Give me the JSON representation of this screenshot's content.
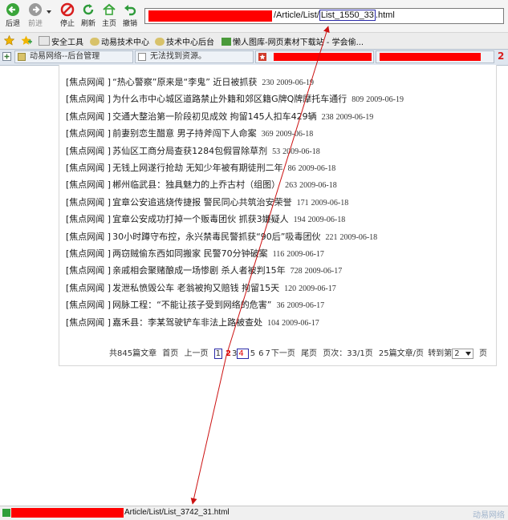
{
  "toolbar": {
    "back_label": "后退",
    "forward_label": "前进",
    "stop_label": "停止",
    "refresh_label": "刷新",
    "home_label": "主页",
    "undo_label": "撤销"
  },
  "address_bar": {
    "path_prefix": "/Article/List/",
    "path_highlight": "List_1550_33",
    "path_suffix": ".html"
  },
  "favorites": [
    {
      "label": "安全工具"
    },
    {
      "label": "动易技术中心"
    },
    {
      "label": "技术中心后台"
    },
    {
      "label": "懒人图库-网页素材下载站 - 学会偷..."
    }
  ],
  "tabs": [
    {
      "label": "动易网络--后台管理"
    },
    {
      "label": "无法找到资源。"
    }
  ],
  "news_list": [
    {
      "source": "[焦点网闻 ]",
      "title": "“热心警察”原来是“李鬼”  近日被抓获",
      "hits": "230",
      "date": "2009-06-19"
    },
    {
      "source": "[焦点网闻 ]",
      "title": "为什么市中心城区道路禁止外籍和郊区籍G牌Q牌摩托车通行",
      "hits": "809",
      "date": "2009-06-19"
    },
    {
      "source": "[焦点网闻 ]",
      "title": "交通大整治第一阶段初见成效  拘留145人扣车429辆",
      "hits": "238",
      "date": "2009-06-19"
    },
    {
      "source": "[焦点网闻 ]",
      "title": "前妻别恋生醋意  男子持斧闯下人命案",
      "hits": "369",
      "date": "2009-06-18"
    },
    {
      "source": "[焦点网闻 ]",
      "title": "苏仙区工商分局查获1284包假冒除草剂",
      "hits": "53",
      "date": "2009-06-18"
    },
    {
      "source": "[焦点网闻 ]",
      "title": "无钱上网遂行抢劫  无知少年被有期徒刑二年",
      "hits": "86",
      "date": "2009-06-18"
    },
    {
      "source": "[焦点网闻 ]",
      "title": "郴州临武县：独具魅力的上乔古村（组图）",
      "hits": "263",
      "date": "2009-06-18"
    },
    {
      "source": "[焦点网闻 ]",
      "title": "宜章公安追逃烧传捷报  警民同心共筑治安荣誉",
      "hits": "171",
      "date": "2009-06-18"
    },
    {
      "source": "[焦点网闻 ]",
      "title": "宜章公安成功打掉一个贩毒团伙  抓获3嫌疑人",
      "hits": "194",
      "date": "2009-06-18"
    },
    {
      "source": "[焦点网闻 ]",
      "title": "30小时蹲守布控，永兴禁毒民警抓获“90后”吸毒团伙",
      "hits": "221",
      "date": "2009-06-18"
    },
    {
      "source": "[焦点网闻 ]",
      "title": "两窃贼偷东西如同搬家  民警70分钟破案",
      "hits": "116",
      "date": "2009-06-17"
    },
    {
      "source": "[焦点网闻 ]",
      "title": "亲戚相会聚赌酿成一场惨剧  杀人者被判15年",
      "hits": "728",
      "date": "2009-06-17"
    },
    {
      "source": "[焦点网闻 ]",
      "title": "发泄私愤毁公车    老翁被拘又赔钱  拘留15天",
      "hits": "120",
      "date": "2009-06-17"
    },
    {
      "source": "[焦点网闻 ]",
      "title": "网脉工程：“不能让孩子受到网络的危害”",
      "hits": "36",
      "date": "2009-06-17"
    },
    {
      "source": "[焦点网闻 ]",
      "title": "嘉禾县：李某驾驶铲车非法上路被查处",
      "hits": "104",
      "date": "2009-06-17"
    }
  ],
  "pager": {
    "total": "共845篇文章",
    "first": "首页",
    "prev": "上一页",
    "page1": "1",
    "page2": "2",
    "page3": "3",
    "page4": "4",
    "page5": "5",
    "page6": "6",
    "page7": "7",
    "next": "下一页",
    "last": "尾页",
    "page_count": "页次：33/1页",
    "per_page": "25篇文章/页",
    "goto_label": "转到第",
    "goto_value": "2",
    "goto_suffix": "页"
  },
  "status_bar": {
    "path": "Article/List/List_3742_31.html",
    "right_text": "动易网络"
  },
  "colors": {
    "redaction": "#ff0000",
    "annotation_arrow": "#cc1111",
    "highlight_box": "#2a2aa8"
  }
}
